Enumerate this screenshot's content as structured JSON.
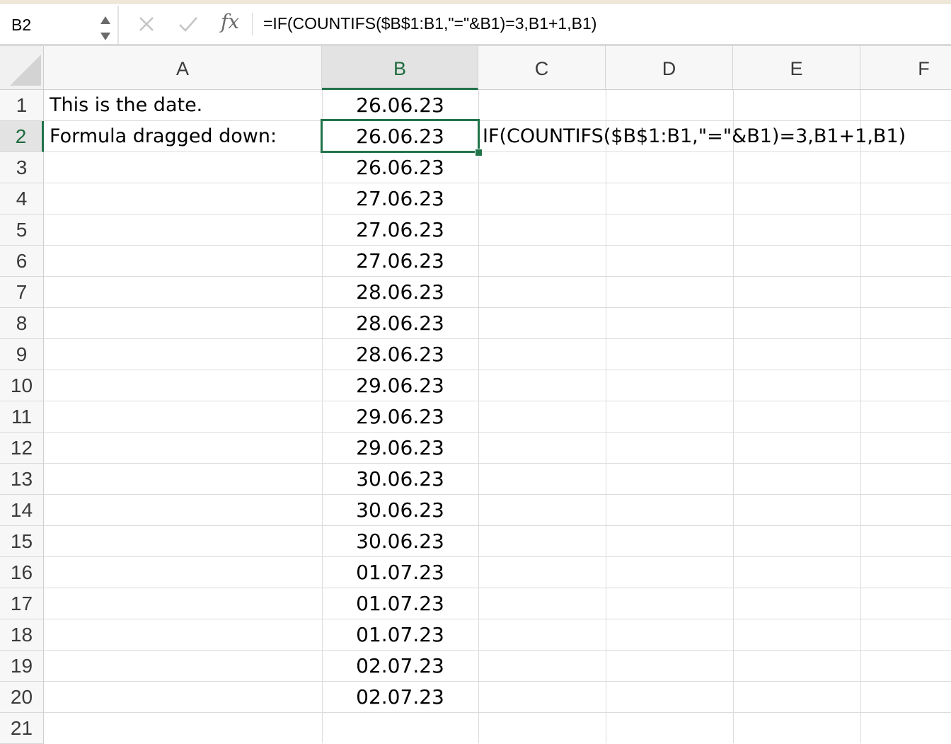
{
  "formula_bar": {
    "name_box": "B2",
    "cancel_icon": "close-icon",
    "enter_icon": "check-icon",
    "fx_label": "fx",
    "formula": "=IF(COUNTIFS($B$1:B1,\"=\"&B1)=3,B1+1,B1)"
  },
  "columns": [
    "A",
    "B",
    "C",
    "D",
    "E",
    "F"
  ],
  "selected_column": "B",
  "rows": [
    "1",
    "2",
    "3",
    "4",
    "5",
    "6",
    "7",
    "8",
    "9",
    "10",
    "11",
    "12",
    "13",
    "14",
    "15",
    "16",
    "17",
    "18",
    "19",
    "20",
    "21"
  ],
  "selected_row": "2",
  "cells": {
    "A1": "This is the date.",
    "A2": "Formula dragged down:",
    "C2": "IF(COUNTIFS($B$1:B1,\"=\"&B1)=3,B1+1,B1)",
    "B": [
      "26.06.23",
      "26.06.23",
      "26.06.23",
      "27.06.23",
      "27.06.23",
      "27.06.23",
      "28.06.23",
      "28.06.23",
      "28.06.23",
      "29.06.23",
      "29.06.23",
      "29.06.23",
      "30.06.23",
      "30.06.23",
      "30.06.23",
      "01.07.23",
      "01.07.23",
      "01.07.23",
      "02.07.23",
      "02.07.23"
    ]
  },
  "active_cell": "B2",
  "colors": {
    "selection": "#21734a",
    "header_bg": "#f7f7f7",
    "gridline": "#dcdcdc"
  }
}
